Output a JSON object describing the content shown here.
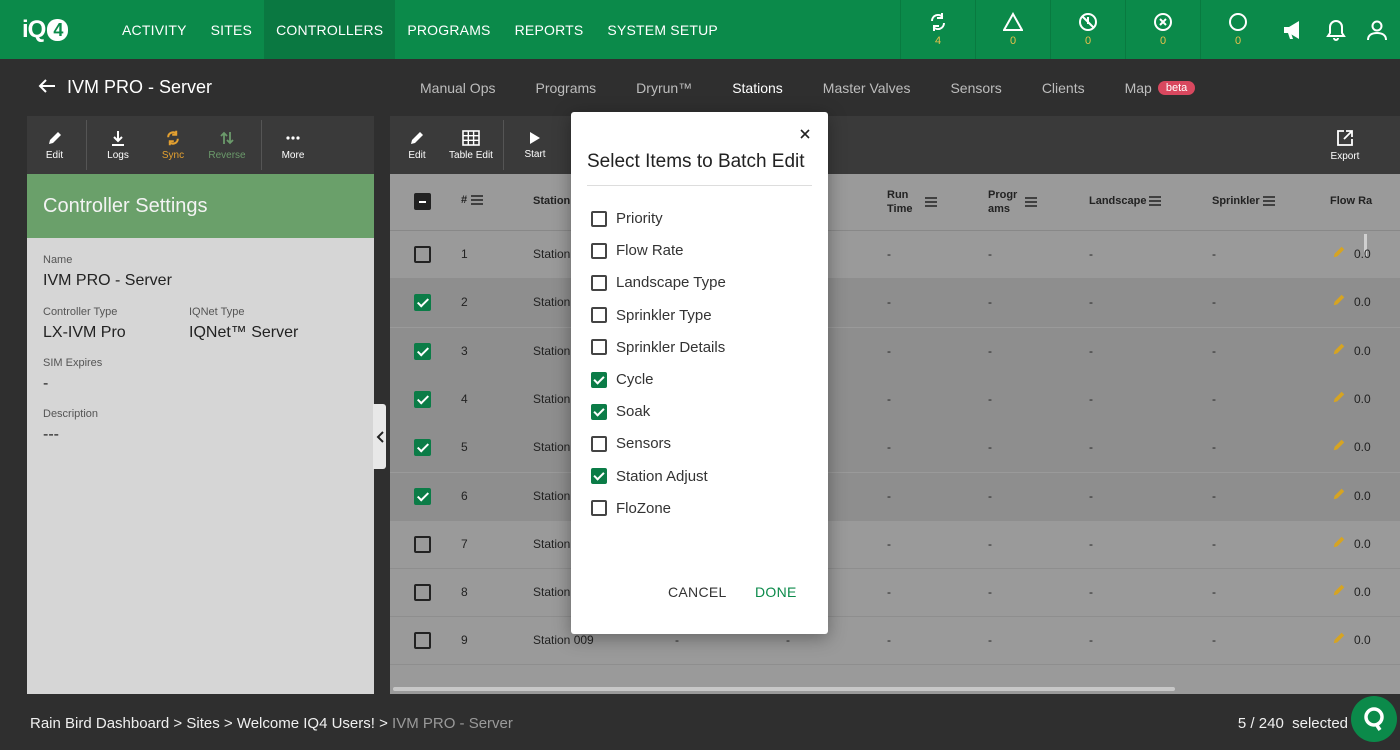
{
  "brand": {
    "logo_text": "iQ",
    "logo_badge": "4"
  },
  "nav": {
    "items": [
      {
        "label": "ACTIVITY"
      },
      {
        "label": "SITES"
      },
      {
        "label": "CONTROLLERS"
      },
      {
        "label": "PROGRAMS"
      },
      {
        "label": "REPORTS"
      },
      {
        "label": "SYSTEM SETUP"
      }
    ],
    "active": "CONTROLLERS"
  },
  "status": [
    {
      "icon": "sync-icon",
      "count": "4"
    },
    {
      "icon": "warning-icon",
      "count": "0"
    },
    {
      "icon": "disabled-icon",
      "count": "0"
    },
    {
      "icon": "error-icon",
      "count": "0"
    },
    {
      "icon": "circle-icon",
      "count": "0"
    }
  ],
  "controller": {
    "title": "IVM PRO - Server"
  },
  "tabs": [
    {
      "label": "Manual Ops"
    },
    {
      "label": "Programs"
    },
    {
      "label": "Dryrun™"
    },
    {
      "label": "Stations"
    },
    {
      "label": "Master Valves"
    },
    {
      "label": "Sensors"
    },
    {
      "label": "Clients"
    },
    {
      "label": "Map",
      "badge": "beta"
    }
  ],
  "left_toolbar": {
    "edit": "Edit",
    "logs": "Logs",
    "sync": "Sync",
    "reverse": "Reverse",
    "more": "More"
  },
  "settings": {
    "heading": "Controller Settings",
    "name_label": "Name",
    "name_value": "IVM PRO - Server",
    "type_label": "Controller Type",
    "type_value": "LX-IVM Pro",
    "iqnet_label": "IQNet Type",
    "iqnet_value": "IQNet™ Server",
    "sim_label": "SIM Expires",
    "sim_value": "-",
    "desc_label": "Description",
    "desc_value": "---"
  },
  "right_toolbar": {
    "edit": "Edit",
    "table_edit": "Table Edit",
    "start": "Start",
    "export": "Export"
  },
  "table": {
    "headers": {
      "num": "#",
      "station": "Station",
      "run_time_1": "Run",
      "run_time_2": "Time",
      "programs_1": "Progr",
      "programs_2": "ams",
      "landscape": "Landscape",
      "sprinkler": "Sprinkler",
      "flow": "Flow Ra"
    },
    "rows": [
      {
        "num": "1",
        "station": "Station",
        "selected": false,
        "run": "-",
        "prog": "-",
        "land": "-",
        "spr": "-",
        "flow": "0.0"
      },
      {
        "num": "2",
        "station": "Station",
        "selected": true,
        "run": "-",
        "prog": "-",
        "land": "-",
        "spr": "-",
        "flow": "0.0"
      },
      {
        "num": "3",
        "station": "Station",
        "selected": true,
        "run": "-",
        "prog": "-",
        "land": "-",
        "spr": "-",
        "flow": "0.0"
      },
      {
        "num": "4",
        "station": "Station",
        "selected": true,
        "run": "-",
        "prog": "-",
        "land": "-",
        "spr": "-",
        "flow": "0.0"
      },
      {
        "num": "5",
        "station": "Station",
        "selected": true,
        "run": "-",
        "prog": "-",
        "land": "-",
        "spr": "-",
        "flow": "0.0"
      },
      {
        "num": "6",
        "station": "Station",
        "selected": true,
        "run": "-",
        "prog": "-",
        "land": "-",
        "spr": "-",
        "flow": "0.0"
      },
      {
        "num": "7",
        "station": "Station",
        "selected": false,
        "run": "-",
        "prog": "-",
        "land": "-",
        "spr": "-",
        "flow": "0.0"
      },
      {
        "num": "8",
        "station": "Station",
        "selected": false,
        "run": "-",
        "prog": "-",
        "land": "-",
        "spr": "-",
        "flow": "0.0"
      },
      {
        "num": "9",
        "station": "Station 009",
        "selected": false,
        "extra1": "-",
        "extra2": "-",
        "run": "-",
        "prog": "-",
        "land": "-",
        "spr": "-",
        "flow": "0.0"
      }
    ]
  },
  "footer": {
    "crumbs": [
      "Rain Bird Dashboard",
      "Sites",
      "Welcome IQ4 Users!",
      "IVM PRO - Server"
    ],
    "separator": ">",
    "selected": "5 / 240  selected"
  },
  "modal": {
    "title": "Select Items to Batch Edit",
    "options": [
      {
        "label": "Priority",
        "checked": false
      },
      {
        "label": "Flow Rate",
        "checked": false
      },
      {
        "label": "Landscape Type",
        "checked": false
      },
      {
        "label": "Sprinkler Type",
        "checked": false
      },
      {
        "label": "Sprinkler Details",
        "checked": false
      },
      {
        "label": "Cycle",
        "checked": true
      },
      {
        "label": "Soak",
        "checked": true
      },
      {
        "label": "Sensors",
        "checked": false
      },
      {
        "label": "Station Adjust",
        "checked": true
      },
      {
        "label": "FloZone",
        "checked": false
      }
    ],
    "cancel": "CANCEL",
    "done": "DONE"
  },
  "colors": {
    "brand_green": "#0b8a4a",
    "status_yellow": "#e8c04a",
    "check_green": "#0b7c47",
    "beta_red": "#d9485f",
    "sync_orange": "#e3a030"
  }
}
